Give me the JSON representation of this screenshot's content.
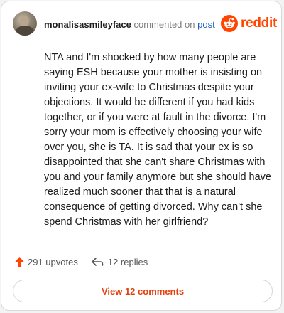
{
  "header": {
    "username": "monalisasmileyface",
    "action_text": "commented on",
    "post_link": "post",
    "brand": "reddit"
  },
  "comment": {
    "body": "NTA and I'm shocked by how many people are saying ESH because your mother is insisting on inviting your ex-wife to Christmas despite your objections. It would be different if you had kids together, or if you were at fault in the divorce. I'm sorry your mom is effectively choosing your wife over you, she is TA. It is sad that your ex is so disappointed that she can't share Christmas with you and your family anymore but she should have realized much sooner that that is a natural consequence of getting divorced. Why can't she spend Christmas with her girlfriend?"
  },
  "stats": {
    "upvotes_label": "291 upvotes",
    "replies_label": "12 replies"
  },
  "footer": {
    "view_comments_label": "View 12 comments"
  },
  "colors": {
    "brand_orange": "#ff4500",
    "link_blue": "#1c5fbf",
    "button_text": "#e3420e"
  },
  "icons": {
    "avatar": "user-avatar",
    "logo": "reddit-snoo-icon",
    "upvote": "upvote-arrow-icon",
    "reply": "reply-arrow-icon"
  }
}
